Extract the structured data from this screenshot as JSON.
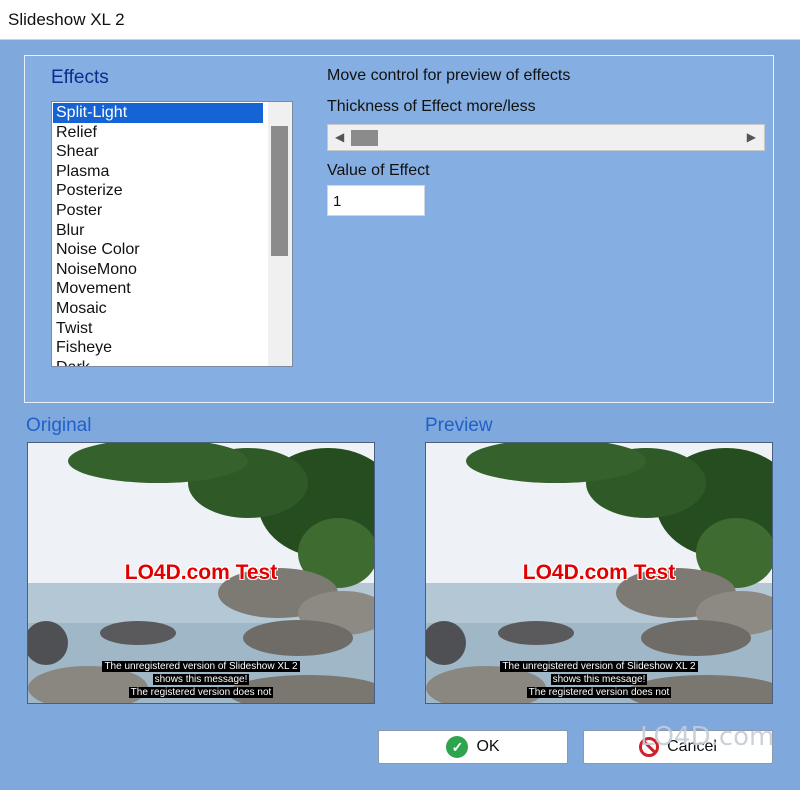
{
  "window": {
    "title": "Slideshow XL 2"
  },
  "effects": {
    "label": "Effects",
    "items": [
      "Split-Light",
      "Relief",
      "Shear",
      "Plasma",
      "Posterize",
      "Poster",
      "Blur",
      "Noise Color",
      "NoiseMono",
      "Movement",
      "Mosaic",
      "Twist",
      "Fisheye",
      "Dark"
    ],
    "selected": "Split-Light"
  },
  "controls": {
    "move_hint": "Move control for preview of effects",
    "thickness_label": "Thickness of Effect more/less",
    "value_label": "Value of Effect",
    "value": "1",
    "scroll_left_icon": "arrow-left-icon",
    "scroll_right_icon": "arrow-right-icon"
  },
  "original": {
    "label": "Original",
    "watermark": "LO4D.com Test",
    "notice_lines": [
      "The unregistered version of Slideshow XL 2",
      "shows this message!",
      "The registered version does not"
    ]
  },
  "preview": {
    "label": "Preview",
    "watermark": "LO4D.com Test",
    "notice_lines": [
      "The unregistered version of Slideshow XL 2",
      "shows this message!",
      "The registered version does not"
    ]
  },
  "buttons": {
    "ok": "OK",
    "cancel": "Cancel"
  },
  "branding": {
    "watermark": "LO4D.com"
  },
  "colors": {
    "accent": "#1464d6",
    "caption": "#2060c8",
    "background": "#7fa8dc"
  }
}
